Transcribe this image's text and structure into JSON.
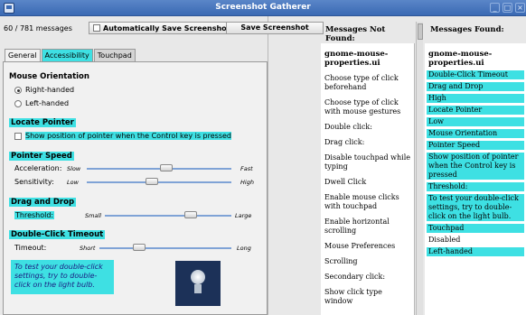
{
  "window": {
    "title": "Screenshot Gatherer",
    "app_icon": "app-window-icon",
    "controls": [
      "_",
      "□",
      "×"
    ]
  },
  "toolbar": {
    "message_count": "60 / 781 messages",
    "auto_save_label": "Automatically Save Screenshots",
    "auto_save_checked": false,
    "save_button": "Save Screenshot"
  },
  "tabs": [
    {
      "label": "General",
      "active": true
    },
    {
      "label": "Accessibility",
      "active": false,
      "highlighted": true
    },
    {
      "label": "Touchpad",
      "active": false
    }
  ],
  "general": {
    "orientation": {
      "heading": "Mouse Orientation",
      "right_handed": "Right-handed",
      "left_handed": "Left-handed",
      "selected": "Right-handed"
    },
    "locate": {
      "heading": "Locate Pointer",
      "checkbox_label": "Show position of pointer when the Control key is pressed",
      "checked": false
    },
    "speed": {
      "heading": "Pointer Speed",
      "acceleration_label": "Acceleration:",
      "acceleration_min": "Slow",
      "acceleration_max": "Fast",
      "acceleration_value": 0.55,
      "sensitivity_label": "Sensitivity:",
      "sensitivity_min": "Low",
      "sensitivity_max": "High",
      "sensitivity_value": 0.45
    },
    "drag": {
      "heading": "Drag and Drop",
      "threshold_label": "Threshold:",
      "threshold_min": "Small",
      "threshold_max": "Large",
      "threshold_value": 0.68
    },
    "double_click": {
      "heading": "Double-Click Timeout",
      "timeout_label": "Timeout:",
      "timeout_min": "Short",
      "timeout_max": "Long",
      "timeout_value": 0.3
    },
    "hint": "To test your double-click settings, try to double-click on the light bulb."
  },
  "not_found": {
    "heading": "Messages Not Found:",
    "items": [
      "gnome-mouse-properties.ui",
      "Choose type of click beforehand",
      "Choose type of click with mouse gestures",
      "Double click:",
      "Drag click:",
      "Disable touchpad while typing",
      "Dwell Click",
      "Enable mouse clicks with touchpad",
      "Enable horizontal scrolling",
      "Mouse Preferences",
      "Scrolling",
      "Secondary click:",
      "Show click type window"
    ]
  },
  "found": {
    "heading": "Messages Found:",
    "items": [
      "gnome-mouse-properties.ui",
      "Double-Click Timeout",
      "Drag and Drop",
      "High",
      "Locate Pointer",
      "Low",
      "Mouse Orientation",
      "Pointer Speed",
      "Show position of pointer when the Control key is pressed",
      "Threshold:",
      "To test your double-click settings, try to double-click on the light bulb.",
      "Touchpad",
      "Disabled",
      "Left-handed"
    ]
  },
  "colors": {
    "highlight": "#3ee0e3",
    "titlebar": "#3a69b3"
  }
}
